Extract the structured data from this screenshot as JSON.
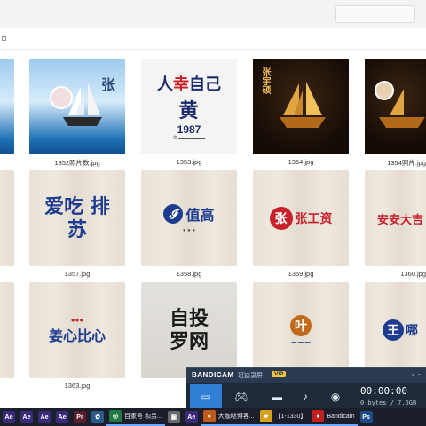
{
  "files": [
    {
      "caption": "",
      "name_text": "",
      "style": "sea-left"
    },
    {
      "caption": "1352照片数.jpg",
      "name_text": "张",
      "style": "sea"
    },
    {
      "caption": "1353.jpg",
      "name_text": "黄",
      "sub_text": "1987",
      "style": "light"
    },
    {
      "caption": "1354.jpg",
      "name_text": "张宇硕",
      "style": "gold"
    },
    {
      "caption": "1354照片.jpg",
      "name_text": "",
      "style": "gold-right"
    },
    {
      "caption": "",
      "name_text": "",
      "style": "wall-left"
    },
    {
      "caption": "1357.jpg",
      "name_text": "爱吃 排苏",
      "style": "wall"
    },
    {
      "caption": "1358.jpg",
      "name_text": "值高",
      "style": "wall"
    },
    {
      "caption": "1359.jpg",
      "name_text": "张工资",
      "style": "wall"
    },
    {
      "caption": "1360.jpg",
      "name_text": "安安大吉",
      "style": "wall-right"
    },
    {
      "caption": "",
      "name_text": "",
      "style": "wall-left"
    },
    {
      "caption": "1363.jpg",
      "name_text": "姜心比心",
      "style": "wall"
    },
    {
      "caption": "",
      "name_text": "自投 罗网",
      "style": "grey"
    },
    {
      "caption": "",
      "name_text": "叶",
      "style": "wall"
    },
    {
      "caption": "",
      "name_text": "王哪",
      "style": "wall-right"
    }
  ],
  "bandicam": {
    "brand": "BANDICAM",
    "mode_label": "班迪录屏",
    "vip_label": "VIP",
    "timer": "00:00:00",
    "size": "0 bytes / 7.5GB"
  },
  "taskbar": {
    "items": [
      {
        "icon": "Ae",
        "label": "",
        "color": "#3b2a7a"
      },
      {
        "icon": "Ae",
        "label": "",
        "color": "#3b2a7a"
      },
      {
        "icon": "Ae",
        "label": "",
        "color": "#3b2a7a"
      },
      {
        "icon": "Ae",
        "label": "",
        "color": "#3b2a7a"
      },
      {
        "icon": "Pr",
        "label": "",
        "color": "#5a1f2a"
      },
      {
        "icon": "✿",
        "label": "",
        "color": "#2a5a8a"
      },
      {
        "icon": "◎",
        "label": "百家号 和另...",
        "color": "#1f7a44"
      },
      {
        "icon": "▣",
        "label": "",
        "color": "#6a6a6a"
      },
      {
        "icon": "Ae",
        "label": "",
        "color": "#3b2a7a"
      },
      {
        "icon": "●",
        "label": "大咖哒博客...",
        "color": "#c05a1a"
      },
      {
        "icon": "▰",
        "label": "【1-1330】",
        "color": "#d6a21a"
      },
      {
        "icon": "●",
        "label": "Bandicam",
        "color": "#c02020"
      },
      {
        "icon": "Ps",
        "label": "",
        "color": "#1e4c8a"
      }
    ]
  },
  "colors": {
    "bandicam_bg": "#1e2a3a",
    "bandicam_active": "#2f80d4",
    "taskbar_bg": "#1a1f2b"
  }
}
